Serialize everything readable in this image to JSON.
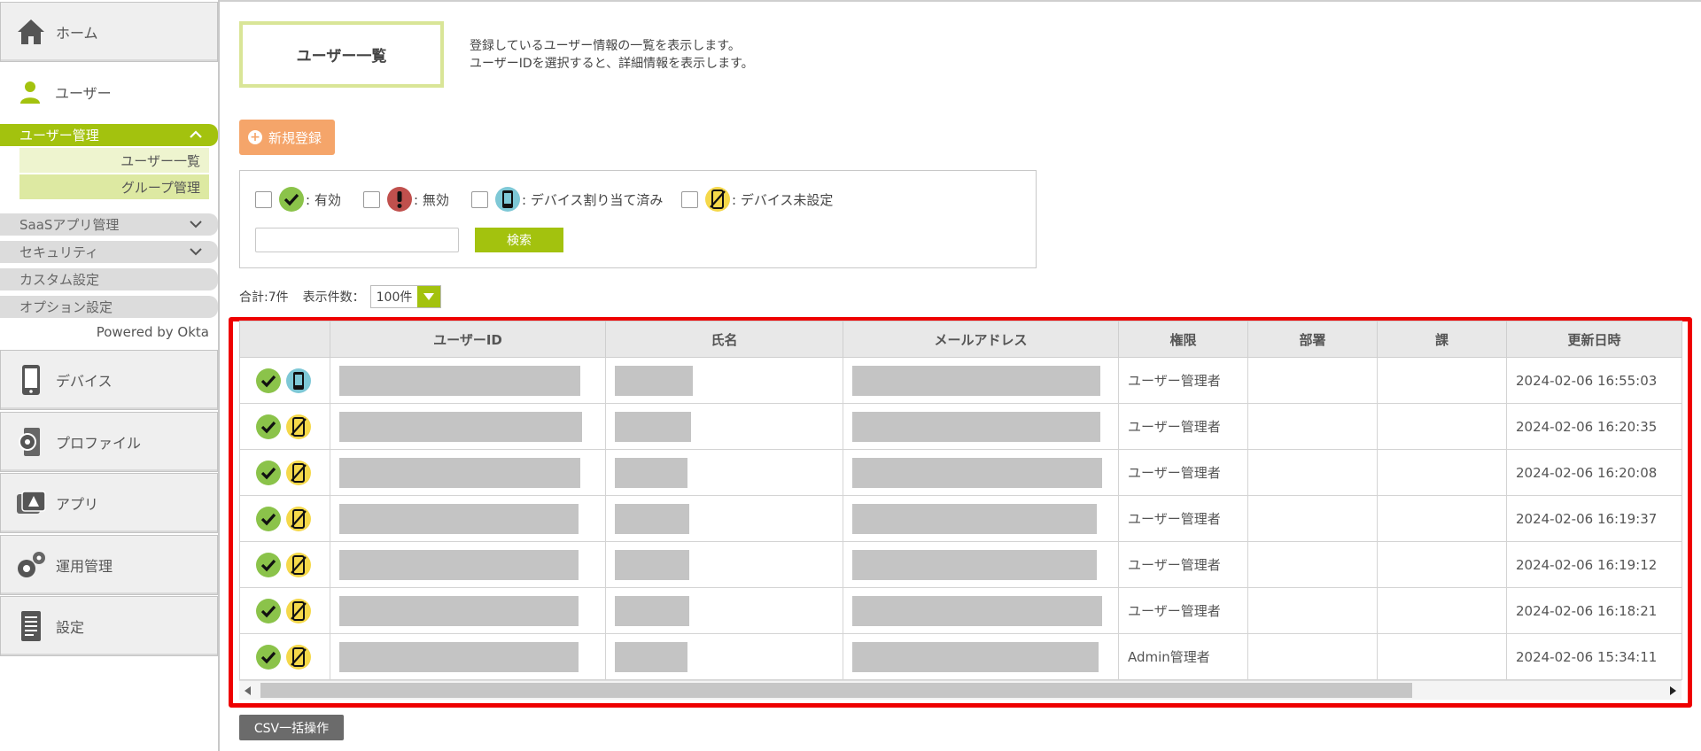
{
  "sidebar": {
    "home_label": "ホーム",
    "users_label": "ユーザー",
    "user_mgmt_label": "ユーザー管理",
    "sub_items": [
      {
        "label": "ユーザー一覧"
      },
      {
        "label": "グループ管理"
      }
    ],
    "categories": [
      {
        "label": "SaaSアプリ管理"
      },
      {
        "label": "セキュリティ"
      },
      {
        "label": "カスタム設定"
      },
      {
        "label": "オプション設定"
      }
    ],
    "powered": "Powered by Okta",
    "nav": [
      {
        "label": "デバイス"
      },
      {
        "label": "プロファイル"
      },
      {
        "label": "アプリ"
      },
      {
        "label": "運用管理"
      },
      {
        "label": "設定"
      }
    ]
  },
  "page": {
    "title": "ユーザー一覧",
    "desc1": "登録しているユーザー情報の一覧を表示します。",
    "desc2": "ユーザーIDを選択すると、詳細情報を表示します。",
    "new_button": "新規登録"
  },
  "filters": {
    "active": ": 有効",
    "disabled": ": 無効",
    "device_assigned": ": デバイス割り当て済み",
    "device_unset": ": デバイス未設定",
    "search_value": "",
    "search_button": "検索"
  },
  "summary": {
    "total": "合計:7件",
    "per_page_label": "表示件数：",
    "per_page_value": "100件"
  },
  "table": {
    "headers": [
      "",
      "ユーザーID",
      "氏名",
      "メールアドレス",
      "権限",
      "部署",
      "課",
      "更新日時"
    ],
    "rows": [
      {
        "device": "assigned",
        "role": "ユーザー管理者",
        "updated": "2024-02-06 16:55:03"
      },
      {
        "device": "unset",
        "role": "ユーザー管理者",
        "updated": "2024-02-06 16:20:35"
      },
      {
        "device": "unset",
        "role": "ユーザー管理者",
        "updated": "2024-02-06 16:20:08"
      },
      {
        "device": "unset",
        "role": "ユーザー管理者",
        "updated": "2024-02-06 16:19:37"
      },
      {
        "device": "unset",
        "role": "ユーザー管理者",
        "updated": "2024-02-06 16:19:12"
      },
      {
        "device": "unset",
        "role": "ユーザー管理者",
        "updated": "2024-02-06 16:18:21"
      },
      {
        "device": "unset",
        "role": "Admin管理者",
        "updated": "2024-02-06 15:34:11"
      }
    ]
  },
  "csv_button": "CSV一括操作",
  "colors": {
    "accent_green": "#a3c20e",
    "orange": "#f5a56a",
    "highlight_red": "#ee0000",
    "status_ok": "#8bc34a",
    "status_ng": "#c0504d",
    "device_blue": "#7ec8d6",
    "device_yellow": "#f5d84a"
  },
  "icons": {
    "status": "check-circle-icon",
    "device_assigned": "phone-icon",
    "device_unset": "phone-slash-icon"
  }
}
